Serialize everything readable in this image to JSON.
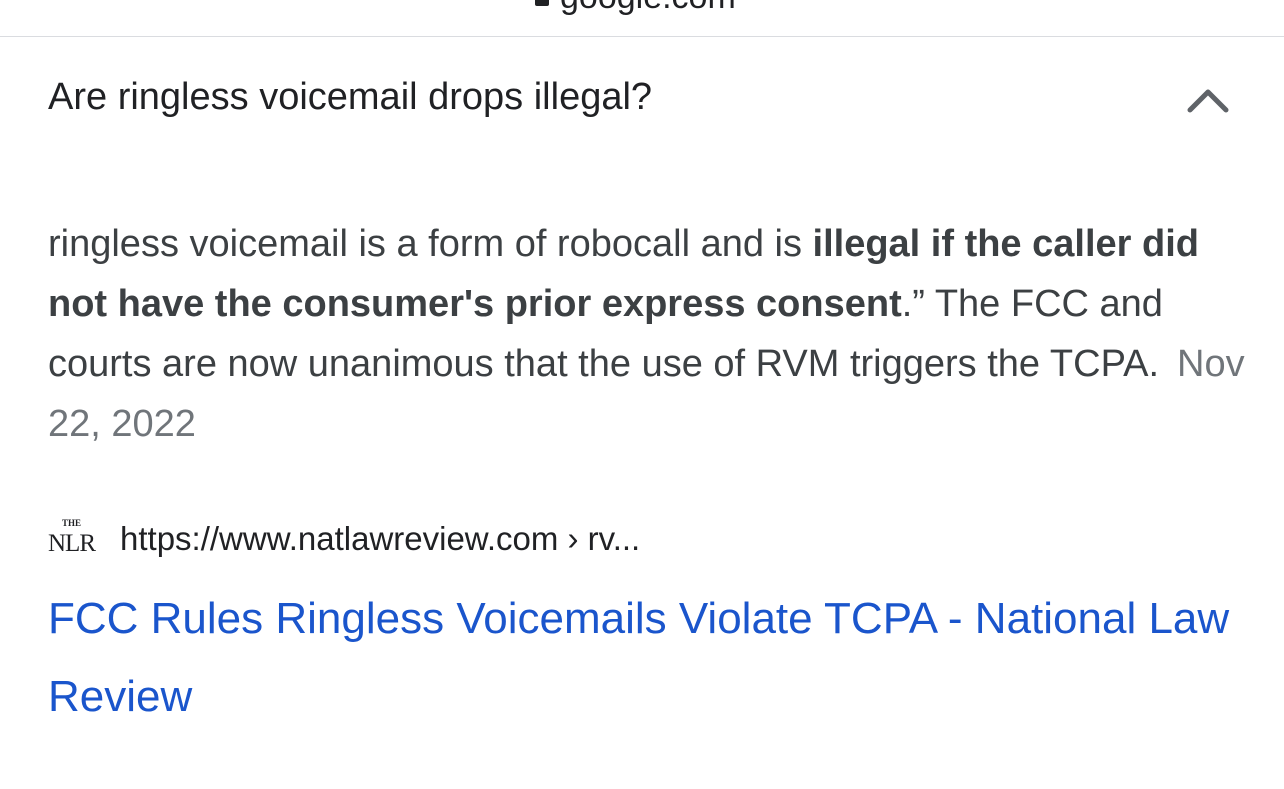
{
  "browser": {
    "domain": "google.com"
  },
  "faq": {
    "question": "Are ringless voicemail drops illegal?",
    "expanded_icon": "chevron-up-icon",
    "answer_part1": "ringless voicemail is a form of robocall and is ",
    "answer_bold": "illegal if the caller did not have the consumer's prior express consent",
    "answer_part2": ".” The FCC and courts are now unanimous that the use of RVM triggers the TCPA.",
    "date": "Nov 22, 2022"
  },
  "source": {
    "favicon_small": "THE",
    "favicon_text": "NLR",
    "url": "https://www.natlawreview.com › rv..."
  },
  "result": {
    "title": "FCC Rules Ringless Voicemails Violate TCPA - National Law Review"
  },
  "colors": {
    "link": "#1a55cc",
    "text": "#3c4043",
    "date": "#70757a"
  }
}
